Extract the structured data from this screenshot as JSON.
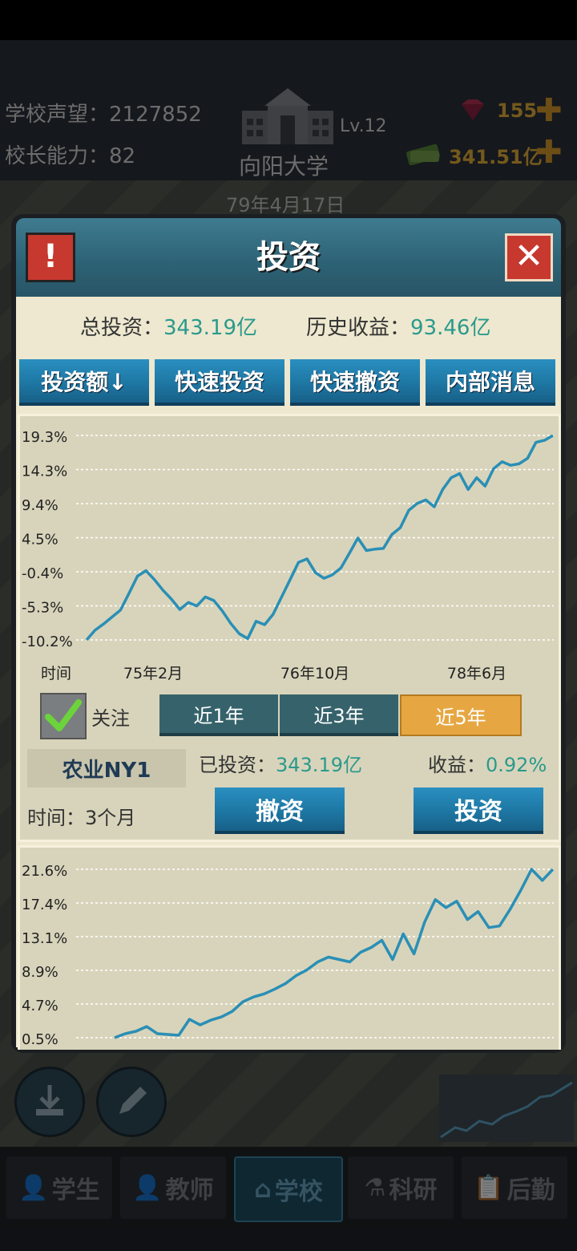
{
  "hud": {
    "reputation_label": "学校声望：",
    "reputation_value": "2127852",
    "ability_label": "校长能力：",
    "ability_value": "82",
    "school_name": "向阳大学",
    "level": "Lv.12",
    "date": "79年4月17日",
    "gems": "155",
    "money": "341.51亿"
  },
  "dialog": {
    "title": "投资",
    "summary": {
      "total_label": "总投资：",
      "total_value": "343.19亿",
      "history_label": "历史收益：",
      "history_value": "93.46亿"
    },
    "tabs": [
      "投资额↓",
      "快速投资",
      "快速撤资",
      "内部消息"
    ],
    "item": {
      "name": "农业NY1",
      "watch_label": "关注",
      "watch_checked": true,
      "periods": [
        "近1年",
        "近3年",
        "近5年"
      ],
      "active_period": "近5年",
      "invested_label": "已投资：",
      "invested_value": "343.19亿",
      "return_label": "收益：",
      "return_value": "0.92%",
      "time_label": "时间：",
      "time_value": "3个月",
      "withdraw_label": "撤资",
      "invest_label": "投资"
    }
  },
  "chart_data": [
    {
      "type": "line",
      "xlabel": "时间",
      "x_ticks": [
        "75年2月",
        "76年10月",
        "78年6月"
      ],
      "y_ticks": [
        "19.3%",
        "14.3%",
        "9.4%",
        "4.5%",
        "-0.4%",
        "-5.3%",
        "-10.2%"
      ],
      "ylim": [
        -10.2,
        19.3
      ],
      "line_color": "#2a8fb5",
      "values": [
        -10.2,
        -8.8,
        -7.9,
        -6.9,
        -5.9,
        -3.5,
        -1.0,
        -0.2,
        -1.5,
        -3.0,
        -4.3,
        -5.8,
        -4.8,
        -5.3,
        -4.0,
        -4.5,
        -6.0,
        -7.8,
        -9.3,
        -10.0,
        -7.5,
        -8.0,
        -6.5,
        -4.0,
        -1.5,
        1.0,
        1.5,
        -0.5,
        -1.3,
        -0.8,
        0.2,
        2.3,
        4.5,
        2.7,
        2.9,
        3.0,
        5.0,
        6.0,
        8.5,
        9.5,
        10.0,
        9.0,
        11.5,
        13.2,
        13.8,
        11.5,
        13.2,
        12.0,
        14.5,
        15.5,
        15.0,
        15.2,
        16.0,
        18.3,
        18.6,
        19.3
      ]
    },
    {
      "type": "line",
      "y_ticks": [
        "21.6%",
        "17.4%",
        "13.1%",
        "8.9%",
        "4.7%",
        "0.5%"
      ],
      "ylim": [
        0.5,
        21.6
      ],
      "line_color": "#2a8fb5",
      "values": [
        0.5,
        1.0,
        1.3,
        1.9,
        1.0,
        0.9,
        0.8,
        2.8,
        2.1,
        2.7,
        3.1,
        3.8,
        5.0,
        5.6,
        6.0,
        6.6,
        7.3,
        8.3,
        9.0,
        10.0,
        10.6,
        10.3,
        10.0,
        11.2,
        11.8,
        12.7,
        10.3,
        13.5,
        11.0,
        15.0,
        17.8,
        16.8,
        17.6,
        15.3,
        16.3,
        14.3,
        14.5,
        16.6,
        19.0,
        21.6,
        20.2,
        21.6
      ]
    }
  ]
}
